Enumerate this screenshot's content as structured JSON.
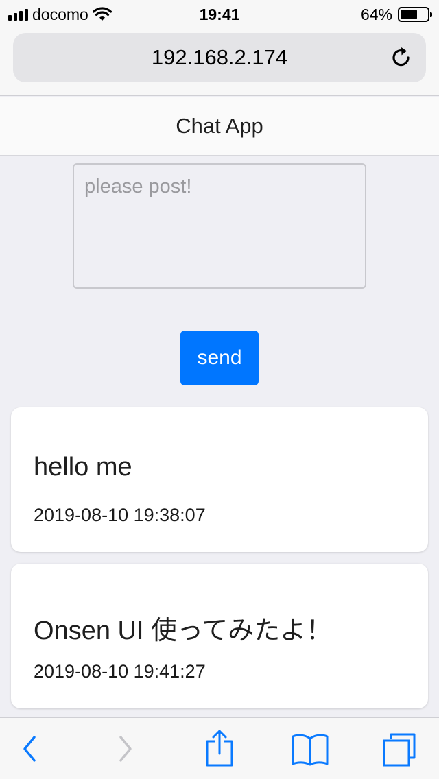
{
  "status_bar": {
    "carrier": "docomo",
    "time": "19:41",
    "battery_percent": "64%",
    "battery_level": 0.64
  },
  "browser": {
    "url": "192.168.2.174"
  },
  "app": {
    "title": "Chat App"
  },
  "composer": {
    "placeholder": "please post!",
    "value": "",
    "send_label": "send"
  },
  "messages": [
    {
      "text": "hello me",
      "timestamp": "2019-08-10 19:38:07"
    },
    {
      "text": "Onsen UI 使ってみたよ！",
      "timestamp": "2019-08-10 19:41:27"
    }
  ],
  "colors": {
    "accent": "#0076ff",
    "background": "#efeff4"
  },
  "icons": {
    "reload": "reload-icon",
    "back": "back-arrow-icon",
    "forward": "forward-arrow-icon",
    "share": "share-icon",
    "bookmarks": "bookmarks-icon",
    "tabs": "tabs-icon"
  }
}
